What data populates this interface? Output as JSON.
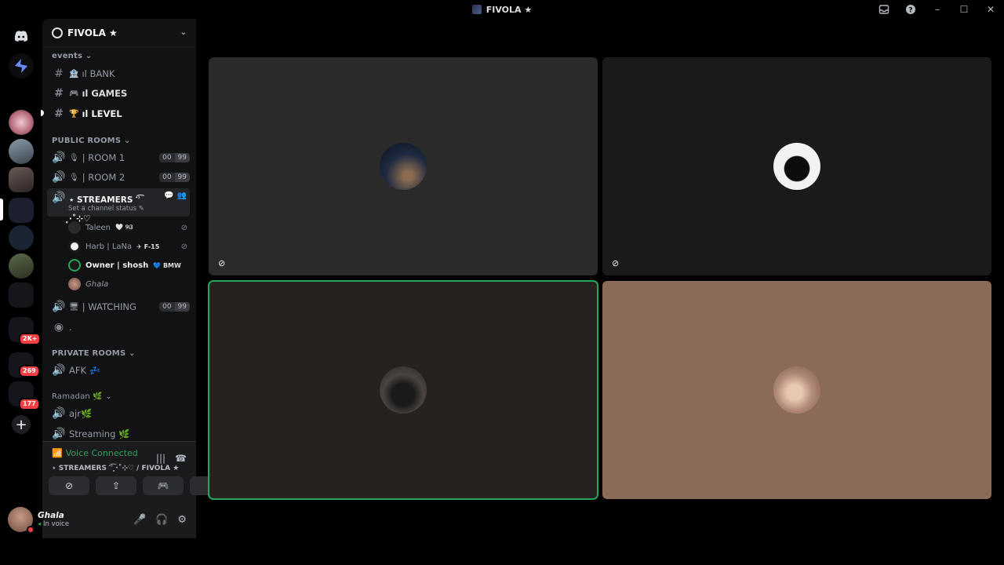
{
  "window": {
    "title": "FIVOLA ★"
  },
  "guild": {
    "name": "FIVOLA ★"
  },
  "categories": {
    "events": "events",
    "public_rooms": "PUBLIC ROOMS",
    "private_rooms": "PRIVATE ROOMS",
    "ramadan": "Ramadan"
  },
  "text_channels": [
    {
      "label": "ıl BANK",
      "emoji": "🏦"
    },
    {
      "label": "ıl GAMES",
      "emoji": "🎮"
    },
    {
      "label": "ıl LEVEL",
      "emoji": "🏆"
    }
  ],
  "voice_channels": {
    "room1": {
      "label": "| ROOM 1",
      "count": "00",
      "limit": "99"
    },
    "room2": {
      "label": "| ROOM 2",
      "count": "00",
      "limit": "99"
    },
    "streamers": {
      "label": "⋆ STREAMERS ་ʾ͡ ̥·˚⊹♡",
      "status": "Set a channel status"
    },
    "watching": {
      "label": "| WATCHING",
      "count": "00",
      "limit": "99"
    },
    "stage": {
      "label": "."
    },
    "afk": {
      "label": "AFK 💤"
    },
    "ajr": {
      "label": "ajr🌿"
    },
    "streaming": {
      "label": "Streaming 🌿"
    }
  },
  "voice_users": [
    {
      "name": "Taleen",
      "tag": "🤍 ୨ଓ"
    },
    {
      "name": "Harb | LaNa",
      "tag": "✈ F-15"
    },
    {
      "name": "Owner | shosh",
      "tag": "💙 BMW"
    },
    {
      "name": "Ghala",
      "tag": ""
    }
  ],
  "server_badges": [
    "2K+",
    "269",
    "177"
  ],
  "voice_panel": {
    "status": "Voice Connected",
    "channel": "⋆ STREAMERS ་ʾ͡ ̥·˚⊹♡ / FIVOLA ★"
  },
  "user": {
    "name": "Ghala",
    "status": "In voice"
  },
  "colors": {
    "accent_green": "#23a55a",
    "tile_1": "#2a2a2b",
    "tile_2": "#1a1a1b",
    "tile_3": "#252220",
    "tile_4": "#8a6b58"
  },
  "icons": {
    "titlebar": [
      "inbox-icon",
      "help-icon",
      "minimize-icon",
      "maximize-icon",
      "close-icon"
    ],
    "voice_panel": [
      "soundboard-icon",
      "disconnect-icon"
    ],
    "voice_buttons": [
      "camera-off-icon",
      "screen-share-icon",
      "activity-icon",
      "soundboard-icon"
    ],
    "user_controls": [
      "microphone-icon",
      "headphones-icon",
      "settings-icon"
    ]
  }
}
